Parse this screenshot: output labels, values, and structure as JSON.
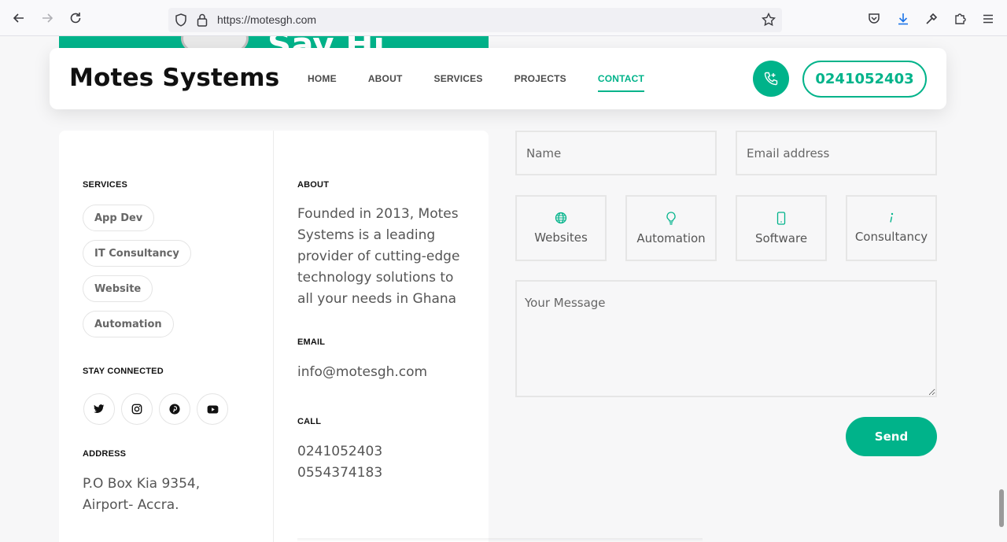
{
  "browser": {
    "url": "https://motesgh.com"
  },
  "hero": {
    "partial_text": "Say Hi"
  },
  "header": {
    "brand": "Motes Systems",
    "menu": [
      "HOME",
      "ABOUT",
      "SERVICES",
      "PROJECTS",
      "CONTACT"
    ],
    "active_menu": "CONTACT",
    "phone": "0241052403"
  },
  "info": {
    "services_title": "SERVICES",
    "services": [
      "App Dev",
      "IT Consultancy",
      "Website",
      "Automation"
    ],
    "stay_connected_title": "STAY CONNECTED",
    "socials": [
      "twitter-icon",
      "instagram-icon",
      "pinterest-icon",
      "youtube-icon"
    ],
    "address_title": "ADDRESS",
    "address_line1": "P.O Box Kia 9354,",
    "address_line2": "Airport- Accra.",
    "about_title": "ABOUT",
    "about_lines": [
      "Founded in 2013, Motes",
      "Systems is a leading",
      "provider of cutting-edge",
      "technology solutions to",
      "all your needs in Ghana"
    ],
    "email_title": "EMAIL",
    "email": "info@motesgh.com",
    "call_title": "CALL",
    "call_numbers": [
      "0241052403",
      "0554374183"
    ]
  },
  "form": {
    "name_placeholder": "Name",
    "email_placeholder": "Email address",
    "options": [
      {
        "label": "Websites",
        "icon": "globe-icon"
      },
      {
        "label": "Automation",
        "icon": "lightbulb-icon"
      },
      {
        "label": "Software",
        "icon": "mobile-icon"
      },
      {
        "label": "Consultancy",
        "icon": "info-icon"
      }
    ],
    "message_placeholder": "Your Message",
    "send_label": "Send"
  },
  "colors": {
    "accent": "#00b38a",
    "text": "#111111",
    "muted": "#555555"
  }
}
